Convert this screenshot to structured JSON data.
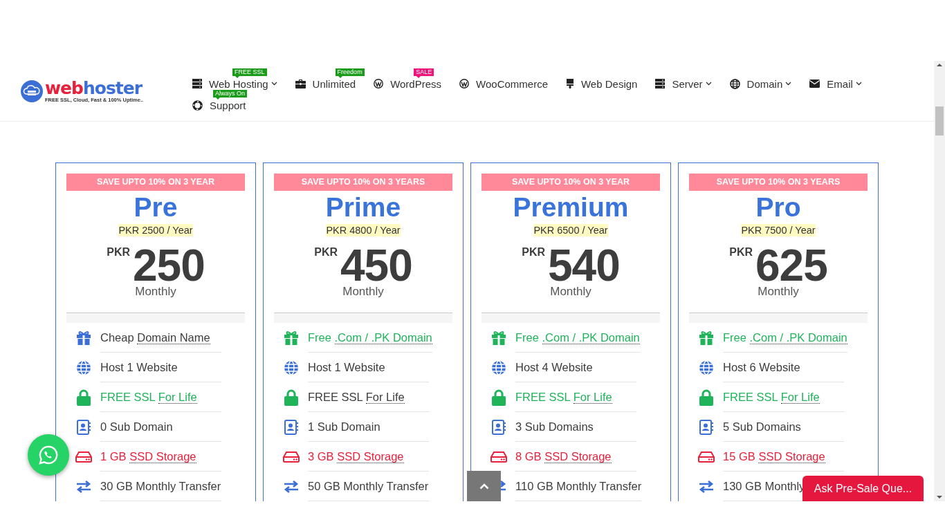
{
  "logo": {
    "word_first": "web",
    "word_second": "hoster",
    "tagline": "FREE SSL, Cloud, Fast & 100% Uptime.."
  },
  "nav": [
    {
      "kind": "server",
      "label": "Web Hosting",
      "caret": true,
      "badge": {
        "text": "FREE SSL",
        "color": "#1a9c1a"
      }
    },
    {
      "kind": "briefcase",
      "label": "Unlimited",
      "caret": false,
      "badge": {
        "text": "Freedom",
        "color": "#1a9c1a"
      }
    },
    {
      "kind": "wordpress",
      "label": "WordPress",
      "caret": false,
      "badge": {
        "text": "SALE",
        "color": "#f0147a"
      }
    },
    {
      "kind": "wordpress",
      "label": "WooCommerce",
      "caret": false
    },
    {
      "kind": "brush",
      "label": "Web Design",
      "caret": false
    },
    {
      "kind": "server",
      "label": "Server",
      "caret": true
    },
    {
      "kind": "globe",
      "label": "Domain",
      "caret": true
    },
    {
      "kind": "envelope",
      "label": "Email",
      "caret": true
    },
    {
      "kind": "lifebuoy",
      "label": "Support",
      "caret": false,
      "badge": {
        "text": "Always On",
        "color": "#1a9c1a"
      }
    }
  ],
  "plans": [
    {
      "ribbon": "SAVE UPTO 10% ON 3 YEAR",
      "name": "Pre",
      "yearly": "PKR 2500 / Year",
      "currency": "PKR",
      "price": "250",
      "period": "Monthly",
      "features": [
        {
          "kind": "gift",
          "color": "#3d3d3d",
          "lead": "Cheap",
          "term": "Domain Name"
        },
        {
          "kind": "globe",
          "color": "#3d3d3d",
          "lead": "Host 1 Website"
        },
        {
          "kind": "lock",
          "color": "#1fb35a",
          "lead": "FREE SSL",
          "term": "For Life"
        },
        {
          "kind": "contact",
          "color": "#3d3d3d",
          "lead": "0 Sub Domain"
        },
        {
          "kind": "drive",
          "color": "#e8203a",
          "lead": "1 GB",
          "term": "SSD Storage"
        },
        {
          "kind": "transfer",
          "color": "#3d3d3d",
          "lead": "30 GB Monthly Transfer"
        }
      ]
    },
    {
      "ribbon": "SAVE UPTO 10% ON 3 YEARS",
      "name": "Prime",
      "yearly": "PKR 4800 / Year",
      "currency": "PKR",
      "price": "450",
      "period": "Monthly",
      "features": [
        {
          "kind": "gift",
          "color": "#1fb35a",
          "lead": "Free",
          "term": ".Com / .PK Domain"
        },
        {
          "kind": "globe",
          "color": "#3d3d3d",
          "lead": "Host 1 Website"
        },
        {
          "kind": "lock",
          "color": "#3d3d3d",
          "lead": "FREE SSL",
          "term": "For Life"
        },
        {
          "kind": "contact",
          "color": "#3d3d3d",
          "lead": "1 Sub Domain"
        },
        {
          "kind": "drive",
          "color": "#e8203a",
          "lead": "3 GB",
          "term": "SSD Storage"
        },
        {
          "kind": "transfer",
          "color": "#3d3d3d",
          "lead": "50 GB Monthly Transfer"
        }
      ]
    },
    {
      "ribbon": "SAVE UPTO 10% ON 3 YEAR",
      "name": "Premium",
      "yearly": "PKR 6500 / Year",
      "currency": "PKR",
      "price": "540",
      "period": "Monthly",
      "features": [
        {
          "kind": "gift",
          "color": "#1fb35a",
          "lead": "Free",
          "term": ".Com / .PK Domain"
        },
        {
          "kind": "globe",
          "color": "#3d3d3d",
          "lead": "Host 4 Website"
        },
        {
          "kind": "lock",
          "color": "#1fb35a",
          "lead": "FREE SSL",
          "term": "For Life"
        },
        {
          "kind": "contact",
          "color": "#3d3d3d",
          "lead": "3 Sub Domains"
        },
        {
          "kind": "drive",
          "color": "#e8203a",
          "lead": "8 GB",
          "term": "SSD Storage"
        },
        {
          "kind": "transfer",
          "color": "#3d3d3d",
          "lead": "110 GB Monthly Transfer"
        }
      ]
    },
    {
      "ribbon": "SAVE UPTO 10% ON 3 YEARS",
      "name": "Pro",
      "yearly": "PKR 7500 / Year",
      "currency": "PKR",
      "price": "625",
      "period": "Monthly",
      "features": [
        {
          "kind": "gift",
          "color": "#1fb35a",
          "lead": "Free",
          "term": ".Com / .PK Domain"
        },
        {
          "kind": "globe",
          "color": "#3d3d3d",
          "lead": "Host 6 Website"
        },
        {
          "kind": "lock",
          "color": "#1fb35a",
          "lead": "FREE SSL",
          "term": "For Life"
        },
        {
          "kind": "contact",
          "color": "#3d3d3d",
          "lead": "5 Sub Domains"
        },
        {
          "kind": "drive",
          "color": "#e8203a",
          "lead": "15 GB",
          "term": "SSD Storage"
        },
        {
          "kind": "transfer",
          "color": "#3d3d3d",
          "lead": "130 GB Monthly"
        }
      ]
    }
  ],
  "chat_button": "Ask Pre-Sale Que..."
}
